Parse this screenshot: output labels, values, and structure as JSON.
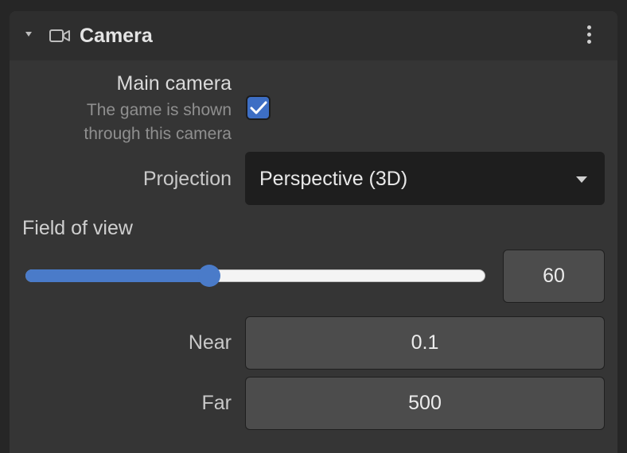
{
  "panel": {
    "title": "Camera",
    "icons": {
      "collapse": "triangle-down-icon",
      "camera": "video-camera-icon",
      "menu": "kebab-menu-icon"
    }
  },
  "main_camera": {
    "label": "Main camera",
    "description_line1": "The game is shown",
    "description_line2": "through this camera",
    "checked": true
  },
  "projection": {
    "label": "Projection",
    "selected": "Perspective (3D)"
  },
  "field_of_view": {
    "label": "Field of view",
    "value": "60",
    "slider_fraction": 0.4
  },
  "near": {
    "label": "Near",
    "value": "0.1"
  },
  "far": {
    "label": "Far",
    "value": "500"
  },
  "colors": {
    "accent": "#4a7bc9",
    "panel_bg": "#353535",
    "header_bg": "#2e2e2e"
  }
}
